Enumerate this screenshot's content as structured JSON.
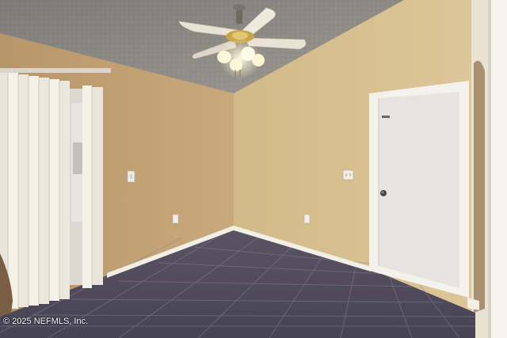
{
  "photo": {
    "subject": "empty-room-interior",
    "watermark_text": "© 2025 NEFMLS, Inc."
  },
  "colors": {
    "ceiling": "#8f8d88",
    "left_wall": "#c6a67a",
    "right_wall": "#d6be8f",
    "baseboard": "#f2efe6",
    "door": "#e6e3e0",
    "door_trim": "#f4f2ec",
    "floor_tile": "#4f4f5f",
    "blinds": "#f2efe4",
    "ceiling_fan_blade": "#e9e3d6",
    "fan_light": "#fff4d2"
  },
  "icons": [
    "ceiling-fan-icon",
    "light-switch-icon",
    "electrical-outlet-icon",
    "door-knob-icon"
  ]
}
